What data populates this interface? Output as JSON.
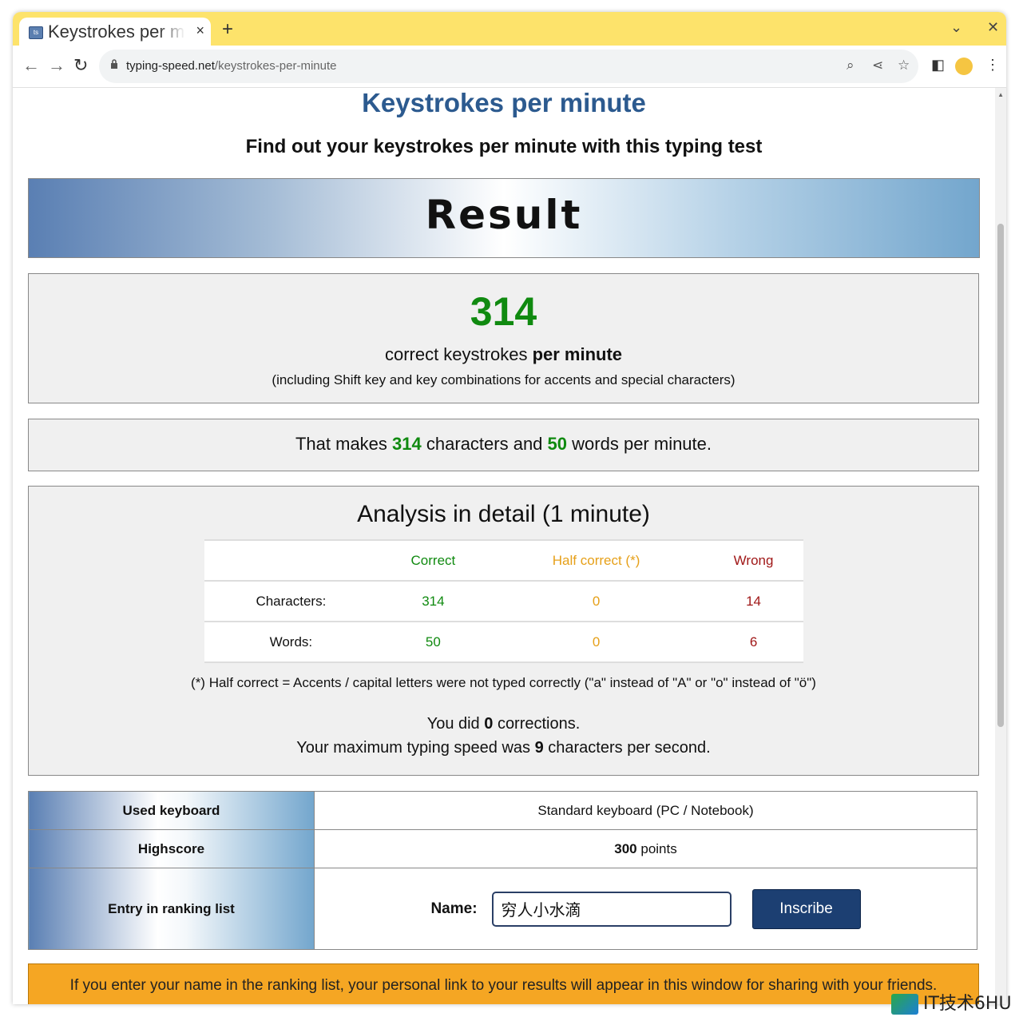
{
  "browser": {
    "tab_title": "Keystrokes per minute",
    "tab_close": "×",
    "new_tab": "+",
    "url_domain": "typing-speed.net",
    "url_path": "/keystrokes-per-minute"
  },
  "page": {
    "title": "Keystrokes per minute",
    "subtitle": "Find out your keystrokes per minute with this typing test",
    "banner": "Result",
    "kpm_value": "314",
    "kpm_text": "correct keystrokes",
    "kpm_bold": "per minute",
    "kpm_note": "(including Shift key and key combinations for accents and special characters)",
    "makes_prefix": "That makes",
    "makes_chars": "314",
    "makes_mid": "characters and",
    "makes_words": "50",
    "makes_suffix": "words per minute."
  },
  "analysis": {
    "title": "Analysis in detail (1 minute)",
    "headers": [
      "",
      "Correct",
      "Half correct (*)",
      "Wrong"
    ],
    "rows": [
      {
        "label": "Characters:",
        "correct": "314",
        "half": "0",
        "wrong": "14"
      },
      {
        "label": "Words:",
        "correct": "50",
        "half": "0",
        "wrong": "6"
      }
    ],
    "note": "(*) Half correct = Accents / capital letters were not typed correctly (\"a\" instead of \"A\" or \"o\" instead of \"ö\")",
    "corrections_prefix": "You did",
    "corrections_value": "0",
    "corrections_suffix": "corrections.",
    "max_prefix": "Your maximum typing speed was",
    "max_value": "9",
    "max_suffix": "characters per second."
  },
  "details": {
    "keyboard_label": "Used keyboard",
    "keyboard_value": "Standard keyboard (PC / Notebook)",
    "highscore_label": "Highscore",
    "highscore_value": "300",
    "highscore_unit": "points",
    "ranking_label": "Entry in ranking list",
    "name_label": "Name:",
    "name_value": "穷人小水滴",
    "inscribe_button": "Inscribe"
  },
  "info_text": "If you enter your name in the ranking list, your personal link to your results will appear in this window for sharing with your friends.",
  "watermark": "IT技术6HU",
  "colors": {
    "accent_blue": "#2c5a8f",
    "green": "#108a10",
    "yellow": "#e6a019",
    "red": "#a01818",
    "orange": "#f5a623",
    "tab_bar": "#fde36b"
  }
}
